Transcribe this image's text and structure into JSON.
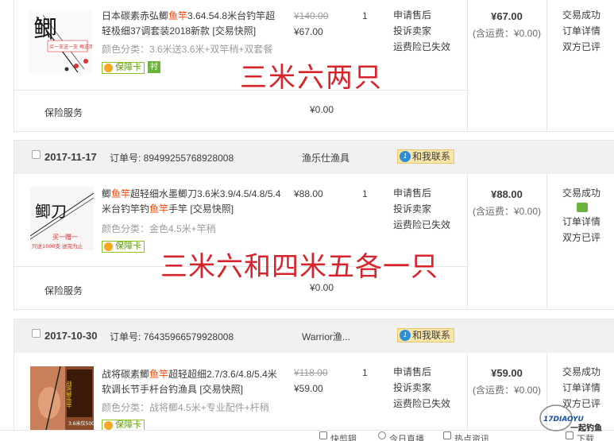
{
  "orders": [
    {
      "items": [
        {
          "title_parts": [
            "日本碳素赤弘鲫",
            "鱼竿",
            "3.64.54.8米台钓竿超轻极细37调套装2018新款 [交易快照]"
          ],
          "attr": "颜色分类：3.6米送3.6米+双竿稍+双套餐",
          "badge": "保障卡",
          "extra_badge": "衬",
          "orig_price": "¥140.00",
          "price": "¥67.00",
          "qty": "1",
          "services": [
            "申请售后",
            "投诉卖家",
            "运费险已失效"
          ],
          "total": "¥67.00",
          "shipping": "(含运费：¥0.00)",
          "status": [
            "交易成功",
            "订单详情",
            "双方已评"
          ],
          "thumb_text": {
            "big": "鲫",
            "small": "买一支送一支 再送双礼包"
          }
        }
      ],
      "insurance": {
        "label": "保险服务",
        "price": "¥0.00"
      }
    },
    {
      "date": "2017-11-17",
      "order_no": "订单号: 89499255768928008",
      "shop": "渔乐仕渔具",
      "contact": "和我联系",
      "items": [
        {
          "title_parts": [
            "鲫",
            "鱼竿",
            "超轻细水墨鲫刀3.6米3.9/4.5/4.8/5.4米台钓竿钓",
            "鱼竿",
            "手竿 [交易快照]"
          ],
          "attr": "颜色分类：金色4.5米+竿稍",
          "badge": "保障卡",
          "price": "¥88.00",
          "qty": "1",
          "services": [
            "申请售后",
            "投诉卖家",
            "运费险已失效"
          ],
          "total": "¥88.00",
          "shipping": "(含运费：¥0.00)",
          "status": [
            "交易成功",
            "订单详情",
            "双方已评"
          ],
          "thumb_text": {
            "big": "鲫刀",
            "small": "买一赠一",
            "red": "只送1000支 送完为止"
          }
        }
      ],
      "insurance": {
        "label": "保险服务",
        "price": "¥0.00"
      }
    },
    {
      "date": "2017-10-30",
      "order_no": "订单号: 76435966579928008",
      "shop": "Warrior渔...",
      "contact": "和我联系",
      "items": [
        {
          "title_parts": [
            "战将碳素鲫",
            "鱼竿",
            "超轻超细2.7/3.6/4.8/5.4米软调长节手杆台钓渔具 [交易快照]"
          ],
          "attr": "颜色分类：战将鲫4.5米+专业配件+杆稍",
          "badge": "保障卡",
          "orig_price": "¥118.00",
          "price": "¥59.00",
          "qty": "1",
          "services": [
            "申请售后",
            "投诉卖家",
            "运费险已失效"
          ],
          "total": "¥59.00",
          "shipping": "(含运费：¥0.00)",
          "status": [
            "交易成功",
            "订单详情",
            "双方已评"
          ],
          "thumb_text": {
            "big": "战将鲫鱼竿",
            "small": "3.6米仅50G"
          }
        }
      ]
    }
  ],
  "overlays": [
    "三米六两只",
    "三米六和四米五各一只"
  ],
  "bottom_bar": [
    "快剪辑",
    "今日直播",
    "热点资讯",
    "下载"
  ],
  "watermark": {
    "brand": "一起钓鱼",
    "url": "17DIAOYU"
  },
  "colors": {
    "highlight": "#ff4400",
    "overlay": "#d8232a",
    "header_bg": "#f1f1f1",
    "badge_green": "#8fc31f",
    "contact_bg": "#f8e6a8"
  },
  "icons": [
    "checkbox-icon",
    "wangwang-icon",
    "shield-icon",
    "chat-icon"
  ]
}
